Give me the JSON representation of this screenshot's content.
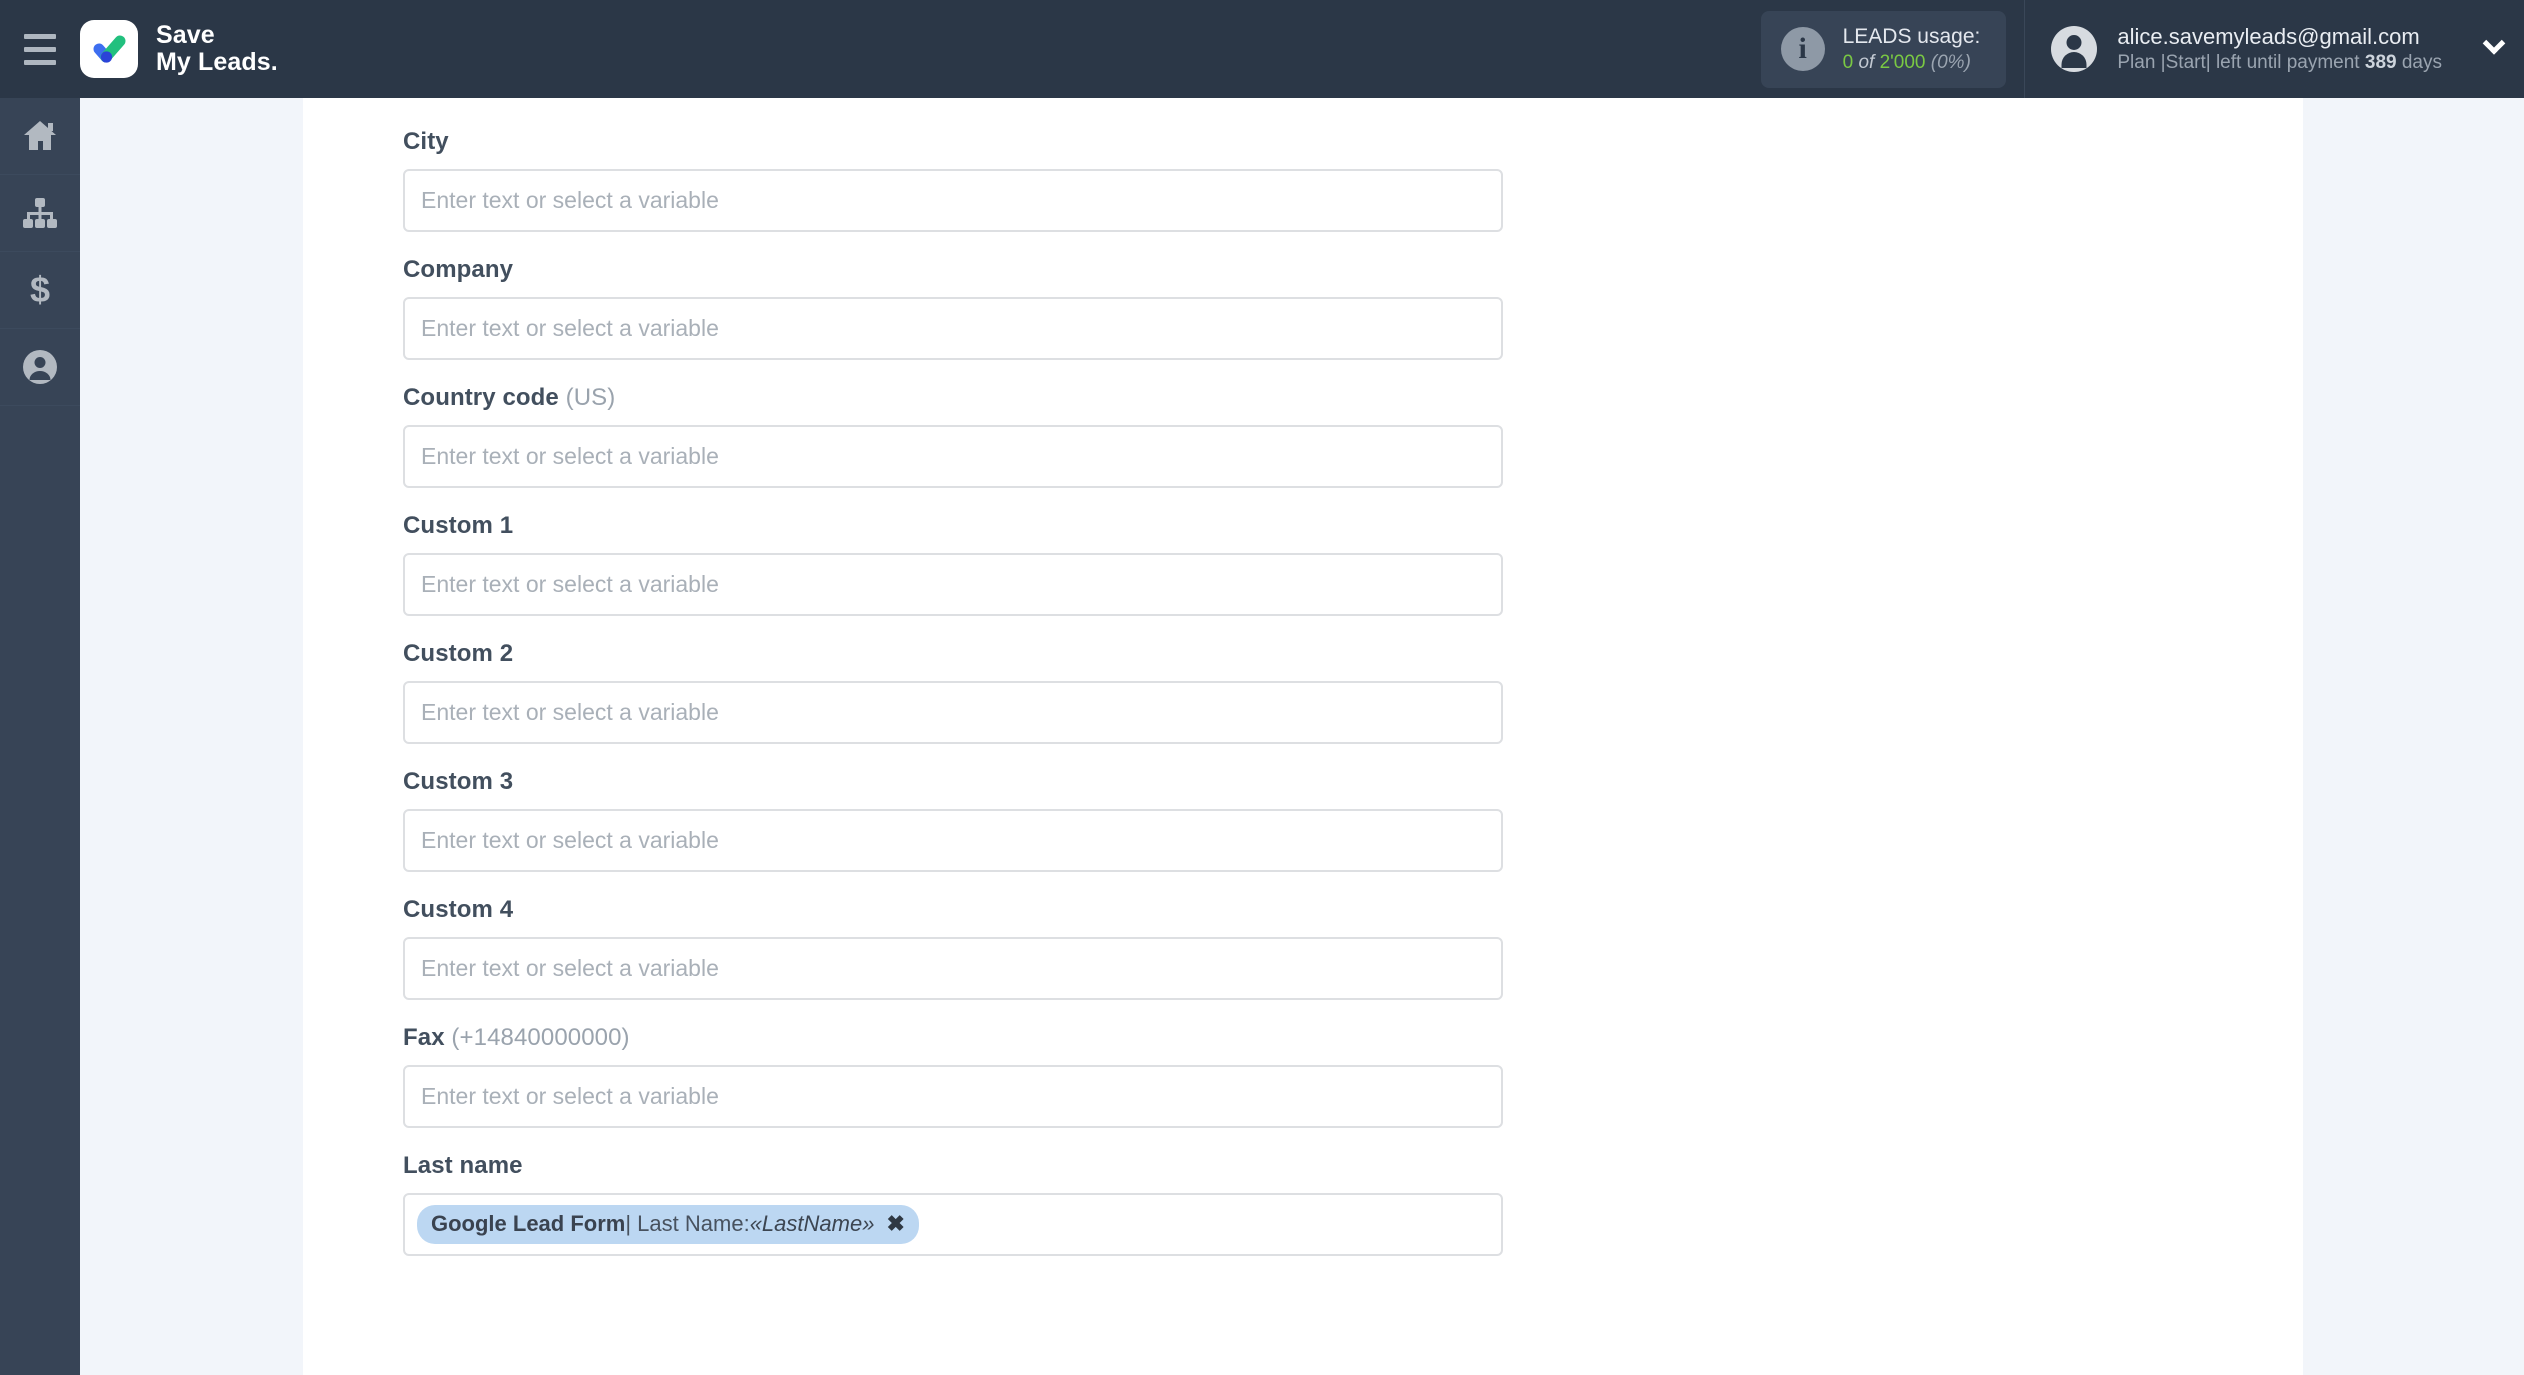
{
  "header": {
    "menu_icon": "hamburger-icon",
    "brand": {
      "line1": "Save",
      "line2": "My Leads",
      "dot": "."
    },
    "usage": {
      "icon": "info-icon",
      "title": "LEADS usage:",
      "used": "0",
      "of": " of ",
      "total": "2'000",
      "percent": "(0%)"
    },
    "account": {
      "avatar_icon": "user-avatar-icon",
      "email": "alice.savemyleads@gmail.com",
      "plan_prefix": "Plan |Start| left until payment ",
      "plan_days": "389",
      "plan_suffix": " days",
      "chevron_icon": "chevron-down-icon"
    }
  },
  "sidebar": {
    "items": [
      {
        "name": "home",
        "icon": "home-icon"
      },
      {
        "name": "connections",
        "icon": "sitemap-icon"
      },
      {
        "name": "billing",
        "icon": "dollar-icon"
      },
      {
        "name": "account",
        "icon": "user-circle-icon"
      }
    ]
  },
  "form": {
    "placeholder": "Enter text or select a variable",
    "fields": [
      {
        "label": "City",
        "hint": "",
        "value": "",
        "type": "placeholder"
      },
      {
        "label": "Company",
        "hint": "",
        "value": "",
        "type": "placeholder"
      },
      {
        "label": "Country code",
        "hint": " (US)",
        "value": "",
        "type": "placeholder"
      },
      {
        "label": "Custom 1",
        "hint": "",
        "value": "",
        "type": "placeholder"
      },
      {
        "label": "Custom 2",
        "hint": "",
        "value": "",
        "type": "placeholder"
      },
      {
        "label": "Custom 3",
        "hint": "",
        "value": "",
        "type": "placeholder"
      },
      {
        "label": "Custom 4",
        "hint": "",
        "value": "",
        "type": "placeholder"
      },
      {
        "label": "Fax",
        "hint": " (+14840000000)",
        "value": "",
        "type": "placeholder"
      },
      {
        "label": "Last name",
        "hint": "",
        "type": "chip",
        "chip": {
          "source": "Google Lead Form",
          "separator": " | Last Name: ",
          "variable": "«LastName»",
          "remove": "✖"
        }
      }
    ]
  },
  "colors": {
    "header_bg": "#2b3747",
    "sidebar_bg": "#374456",
    "page_bg": "#f2f5fa",
    "panel_bg": "#ffffff",
    "chip_bg": "#bcd7f2",
    "usage_green": "#7ac943",
    "logo_blue": "#3d6ef0",
    "logo_green": "#22c07e"
  }
}
